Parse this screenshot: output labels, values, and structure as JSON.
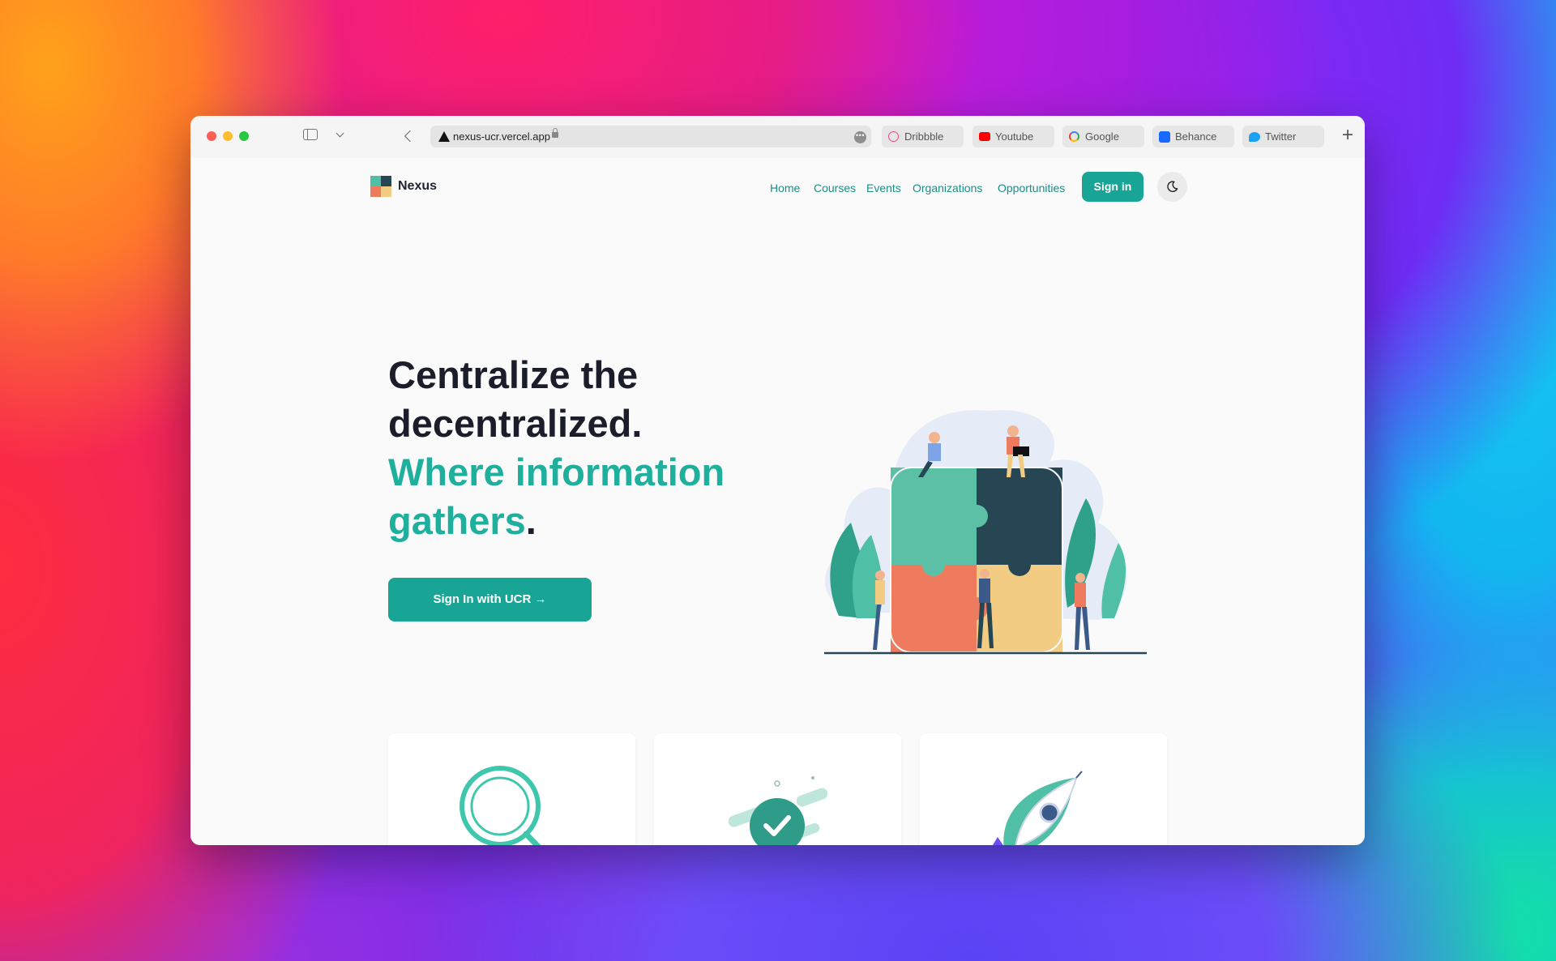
{
  "browser": {
    "url": "nexus-ucr.vercel.app",
    "bookmarks": [
      {
        "label": "Dribbble",
        "icon": "dribbble-icon"
      },
      {
        "label": "Youtube",
        "icon": "youtube-icon"
      },
      {
        "label": "Google",
        "icon": "google-icon"
      },
      {
        "label": "Behance",
        "icon": "behance-icon"
      },
      {
        "label": "Twitter",
        "icon": "twitter-icon"
      }
    ]
  },
  "header": {
    "brand": "Nexus",
    "nav": [
      "Home",
      "Courses",
      "Events",
      "Organizations",
      "Opportunities"
    ],
    "signin_label": "Sign in",
    "theme_icon": "moon-icon"
  },
  "hero": {
    "line1": "Centralize the",
    "line2": "decentralized.",
    "accent1": "Where information",
    "accent2": "gathers",
    "period": ".",
    "cta_label": "Sign In with UCR →"
  },
  "features": [
    {
      "icon": "search-icon"
    },
    {
      "icon": "checkmark-icon"
    },
    {
      "icon": "rocket-icon"
    }
  ],
  "colors": {
    "accent": "#19a596",
    "accent_text": "#1eaf9d",
    "heading": "#1b1e2a"
  }
}
